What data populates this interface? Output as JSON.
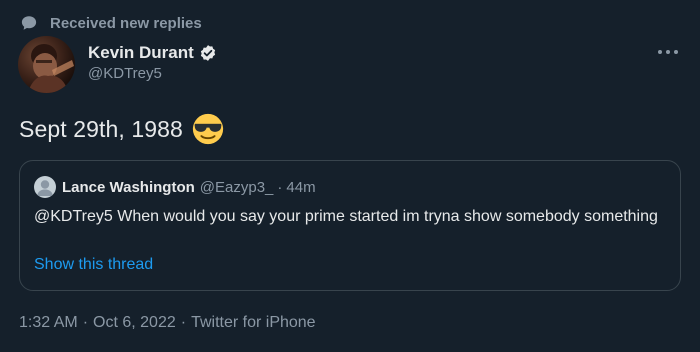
{
  "context": {
    "label": "Received new replies"
  },
  "author": {
    "name": "Kevin Durant",
    "handle": "@KDTrey5"
  },
  "tweet": {
    "text": "Sept 29th, 1988",
    "emoji_icon": "smiling-face-with-sunglasses"
  },
  "quote": {
    "name": "Lance Washington",
    "handle": "@Eazyp3_",
    "separator": "·",
    "time": "44m",
    "text": "@KDTrey5 When would you say your prime started im tryna show somebody something",
    "link": "Show this thread"
  },
  "footer": {
    "time": "1:32 AM",
    "dot1": "·",
    "date": "Oct 6, 2022",
    "dot2": "·",
    "source": "Twitter for iPhone"
  },
  "colors": {
    "background": "#15202b",
    "secondary_text": "#8b98a5",
    "link": "#1d9bf0",
    "border": "#38444d"
  }
}
